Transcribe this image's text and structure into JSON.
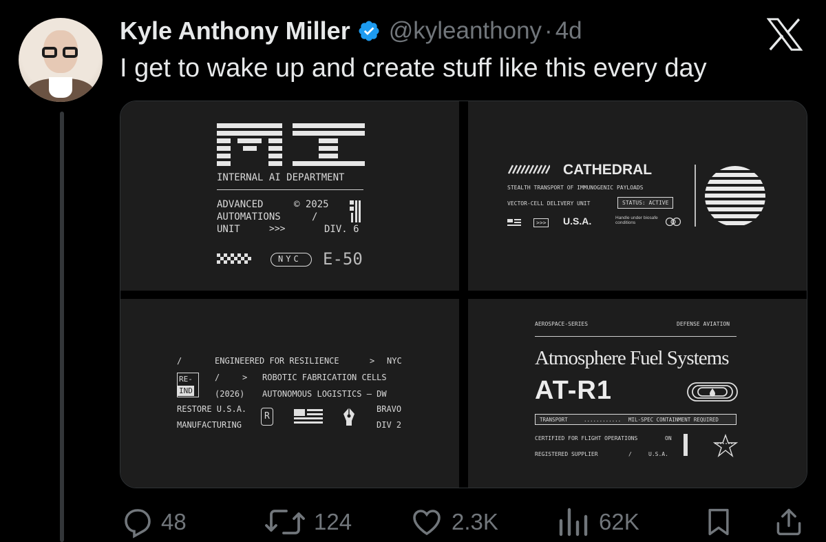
{
  "tweet": {
    "author_name": "Kyle Anthony Miller",
    "handle": "@kyleanthony",
    "separator": "·",
    "age": "4d",
    "text": "I get to wake up and create stuff like this every day"
  },
  "media": {
    "panel1": {
      "department": "INTERNAL AI DEPARTMENT",
      "line1": "ADVANCED",
      "copyright": "© 2025",
      "line2": "AUTOMATIONS",
      "slash": "/",
      "line3": "UNIT",
      "arrows": ">>>",
      "div": "DIV. 6",
      "nyc": "NYC",
      "code": "E-50"
    },
    "panel2": {
      "title": "CATHEDRAL",
      "sub1": "STEALTH TRANSPORT OF IMMUNOGENIC PAYLOADS",
      "sub2": "VECTOR-CELL DELIVERY UNIT",
      "status": "STATUS: ACTIVE",
      "arrows": ">>>",
      "country": "U.S.A.",
      "handle_note": "Handle under biosafe conditions"
    },
    "panel3": {
      "slash1": "/",
      "line1": "ENGINEERED FOR RESILIENCE",
      "gt1": ">",
      "nyc": "NYC",
      "badge_top": "RE-",
      "badge_bottom": "IND",
      "slash2": "/",
      "gt2": ">",
      "line2": "ROBOTIC FABRICATION CELLS",
      "year": "(2026)",
      "line3": "AUTONOMOUS LOGISTICS – DW",
      "restore": "RESTORE U.S.A.",
      "bravo": "BRAVO",
      "manufacturing": "MANUFACTURING",
      "div": "DIV 2",
      "r_mark": "R"
    },
    "panel4": {
      "series": "AEROSPACE-SERIES",
      "defense": "DEFENSE AVIATION",
      "title": "Atmosphere Fuel Systems",
      "model": "AT-R1",
      "transport": "TRANSPORT",
      "dots": "............",
      "milspec": "MIL-SPEC CONTAINMENT REQUIRED",
      "certified": "CERTIFIED FOR FLIGHT OPERATIONS",
      "on": "ON",
      "supplier": "REGISTERED SUPPLIER",
      "slash": "/",
      "usa": "U.S.A."
    }
  },
  "actions": {
    "replies": "48",
    "reposts": "124",
    "likes": "2.3K",
    "views": "62K"
  },
  "icons": [
    "verified-badge-icon",
    "x-logo-icon",
    "reply-icon",
    "repost-icon",
    "like-icon",
    "views-icon",
    "bookmark-icon",
    "share-icon"
  ],
  "colors": {
    "background": "#000000",
    "verified": "#1d9bf0",
    "muted": "#71767b",
    "panel": "#1d1d1d"
  }
}
